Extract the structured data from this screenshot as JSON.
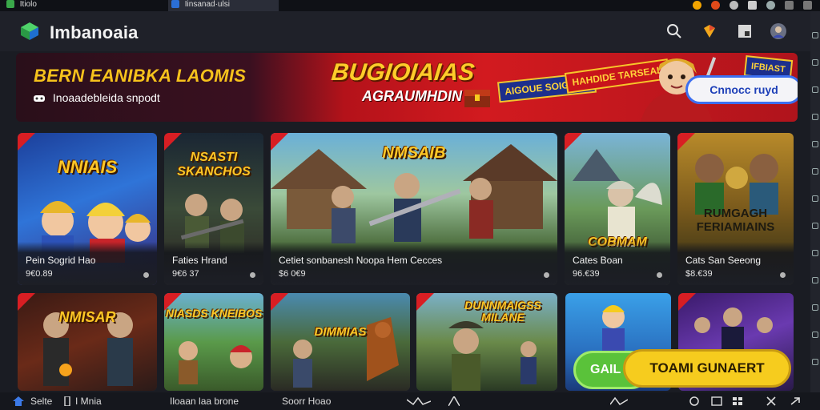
{
  "tabs": [
    {
      "label": "Itiolo",
      "active": false
    },
    {
      "label": "Iinsanad·ulsi",
      "active": true
    }
  ],
  "header": {
    "title": "Imbanoaia",
    "icons": [
      "search-icon",
      "gift-icon",
      "window-icon",
      "avatar-icon"
    ]
  },
  "banner": {
    "headline": "BERN EANIBKA LAOMIS",
    "subline": "Inoaadebleida snpodt",
    "big_title": "BUGIOIAIAS",
    "big_sub": "AGRAUMHDIN",
    "sign_a": "AIGOUE SOIGPOS",
    "sign_b": "HAHDIDE TARSEAL",
    "sign_c": "IFBIAST",
    "cta_label": "Cnnocc ruyd"
  },
  "cards": [
    {
      "art_title": "NNIAIS",
      "name": "Pein Sogrid Hao",
      "meta": "9€0.89"
    },
    {
      "art_title": "NSASTI SKANCHOS",
      "name": "Faties Hrand",
      "meta": "9€6 37"
    },
    {
      "art_title": "NMSAIB",
      "name": "Cetiet sonbanesh Noopa Hem Cecces",
      "meta": "$6 0€9"
    },
    {
      "art_title": "COBMAM",
      "name": "Cates Boan",
      "meta": "96.€39"
    },
    {
      "art_title": "RUMGAGH FERIAMIAINS",
      "name": "Cats San Seeong",
      "meta": "$8.€39"
    },
    {
      "art_title": "NMISAR",
      "name": "",
      "meta": ""
    },
    {
      "art_title": "NIASDS KNEIBOS",
      "name": "",
      "meta": ""
    },
    {
      "art_title": "DIMMIAS",
      "name": "",
      "meta": ""
    },
    {
      "art_title": "DUNNMAIGSS MILANE",
      "name": "",
      "meta": ""
    },
    {
      "art_title": "",
      "name": "",
      "meta": ""
    },
    {
      "art_title": "",
      "name": "",
      "meta": ""
    }
  ],
  "buttons": {
    "green": "GAIL",
    "yellow": "TOAMI GUNAERT"
  },
  "statusbar": {
    "item1": "Selte",
    "item2": "I Mnia",
    "item3": "Iloaan laa brone",
    "item4": "Soorr Hoao"
  },
  "colors": {
    "accent_red": "#d81e23",
    "accent_yellow": "#f6cc1e",
    "cta_blue": "#3c6ff0",
    "green": "#5ac23a"
  }
}
